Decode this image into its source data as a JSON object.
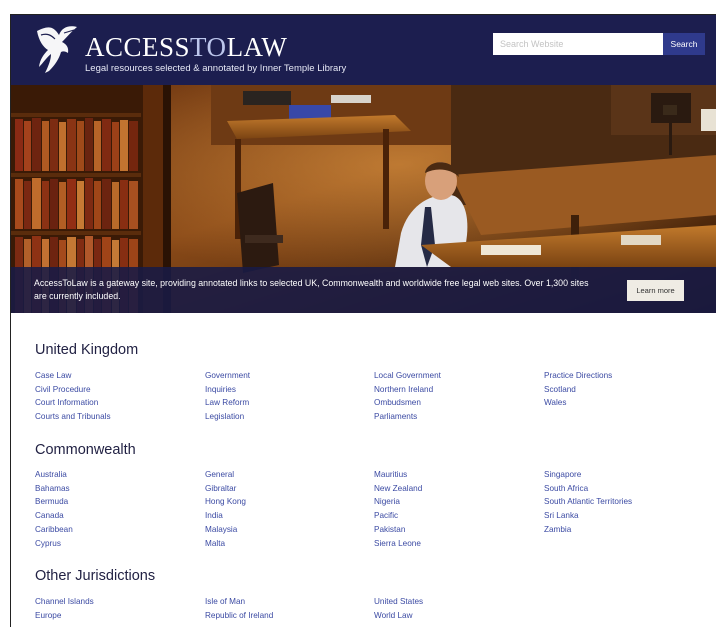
{
  "header": {
    "logo_brand_1": "ACCESS",
    "logo_brand_2": "TO",
    "logo_brand_3": "LAW",
    "tagline": "Legal resources selected & annotated by Inner Temple Library",
    "search_placeholder": "Search Website",
    "search_button_label": "Search",
    "logo_icon": "pegasus-icon"
  },
  "hero": {
    "text": "AccessToLaw is a gateway site, providing annotated links to selected UK, Commonwealth and worldwide free legal web sites. Over 1,300 sites are currently included.",
    "learn_more_label": "Learn more"
  },
  "colors": {
    "header_bg": "#1c1e4f",
    "link": "#3b4aa3",
    "search_button": "#2f3a8c"
  },
  "sections": [
    {
      "title": "United Kingdom",
      "columns": [
        [
          "Case Law",
          "Civil Procedure",
          "Court Information",
          "Courts and Tribunals"
        ],
        [
          "Government",
          "Inquiries",
          "Law Reform",
          "Legislation"
        ],
        [
          "Local Government",
          "Northern Ireland",
          "Ombudsmen",
          "Parliaments"
        ],
        [
          "Practice Directions",
          "Scotland",
          "Wales"
        ]
      ]
    },
    {
      "title": "Commonwealth",
      "columns": [
        [
          "Australia",
          "Bahamas",
          "Bermuda",
          "Canada",
          "Caribbean",
          "Cyprus"
        ],
        [
          "General",
          "Gibraltar",
          "Hong Kong",
          "India",
          "Malaysia",
          "Malta"
        ],
        [
          "Mauritius",
          "New Zealand",
          "Nigeria",
          "Pacific",
          "Pakistan",
          "Sierra Leone"
        ],
        [
          "Singapore",
          "South Africa",
          "South Atlantic Territories",
          "Sri Lanka",
          "Zambia"
        ]
      ]
    },
    {
      "title": "Other Jurisdictions",
      "columns": [
        [
          "Channel Islands",
          "Europe"
        ],
        [
          "Isle of Man",
          "Republic of Ireland"
        ],
        [
          "United States",
          "World Law"
        ]
      ]
    }
  ]
}
